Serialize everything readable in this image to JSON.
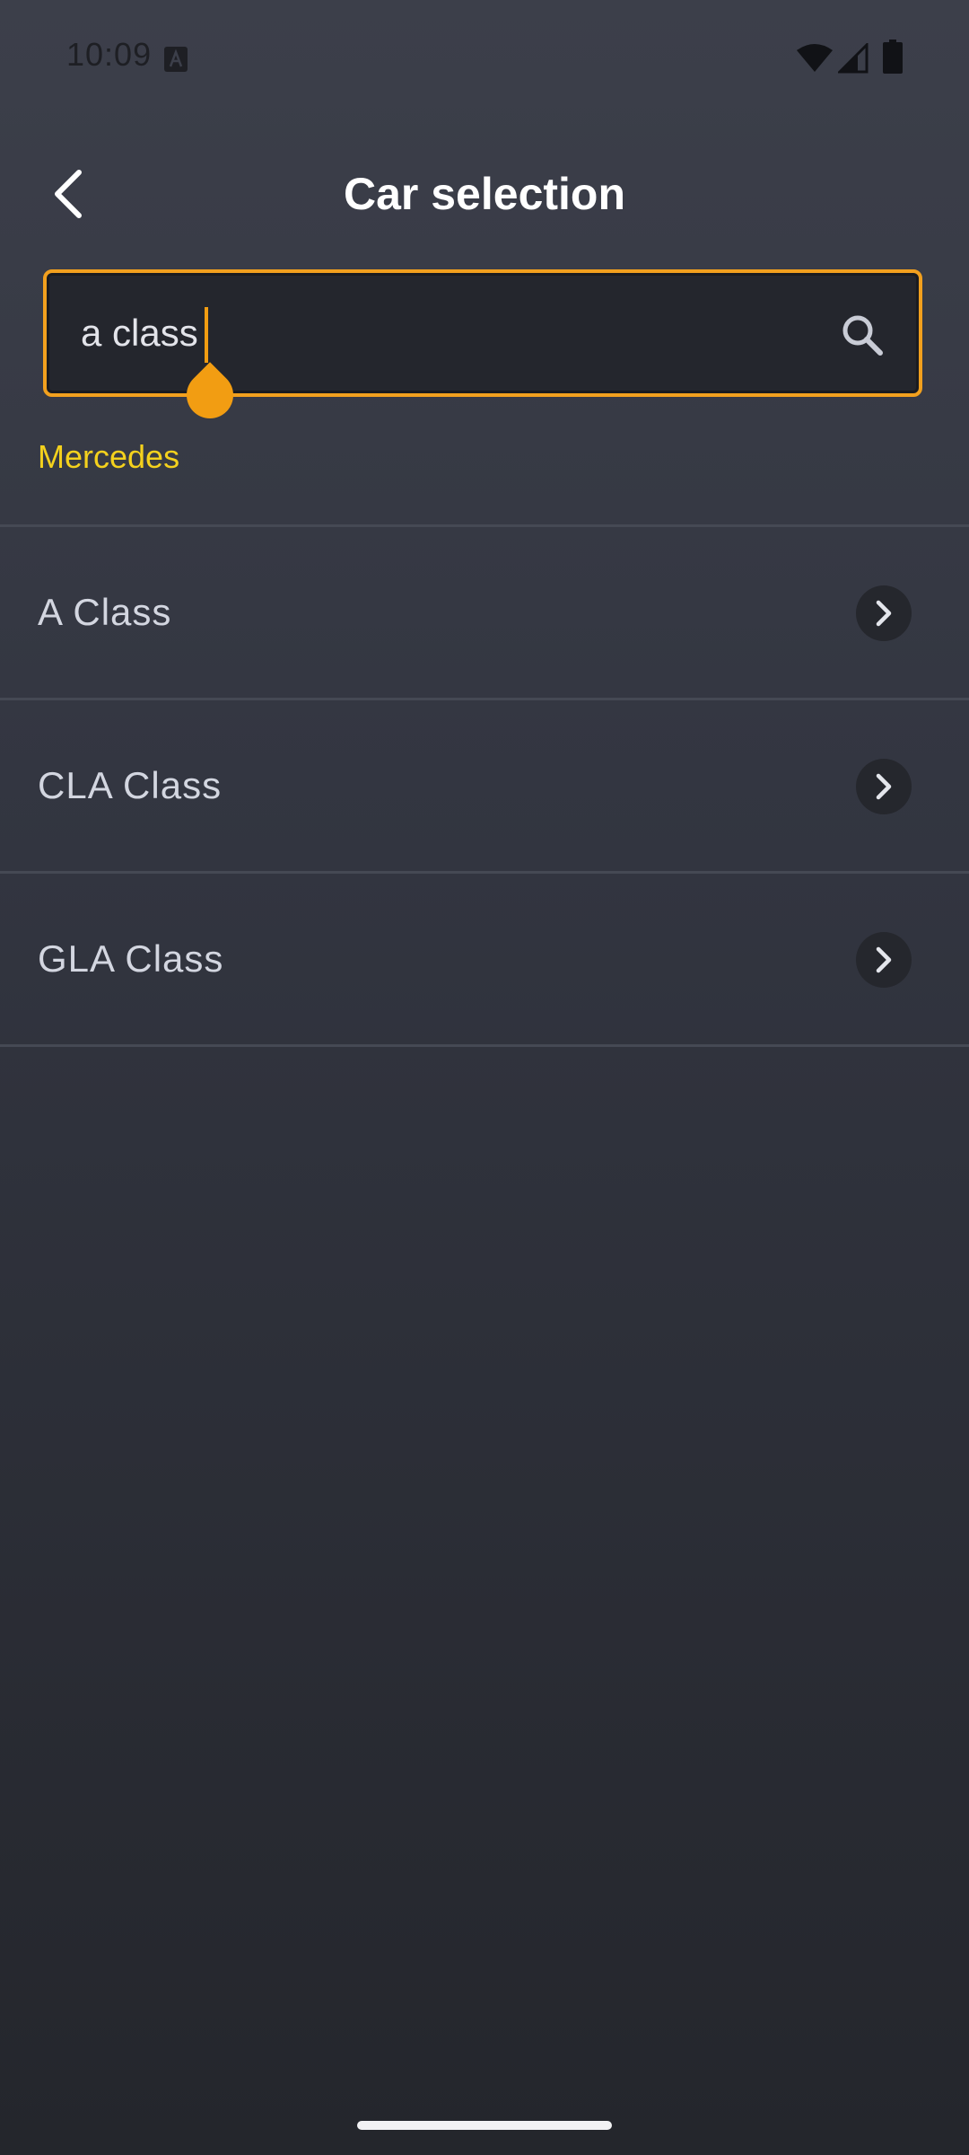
{
  "status_bar": {
    "time": "10:09",
    "icons": [
      "a-icon",
      "wifi-icon",
      "cell-signal-icon",
      "battery-icon"
    ]
  },
  "header": {
    "title": "Car selection",
    "back_icon": "chevron-left-icon"
  },
  "search": {
    "value": "a class",
    "icon": "search-icon",
    "border_color": "#f2a01e"
  },
  "brand": {
    "label": "Mercedes",
    "color": "#f4d11d"
  },
  "models": {
    "items": [
      {
        "label": "A Class",
        "icon": "chevron-right-icon"
      },
      {
        "label": "CLA Class",
        "icon": "chevron-right-icon"
      },
      {
        "label": "GLA Class",
        "icon": "chevron-right-icon"
      }
    ]
  },
  "colors": {
    "accent": "#f29d12",
    "background_top": "#3c3f4a",
    "background_bottom": "#24262c"
  }
}
